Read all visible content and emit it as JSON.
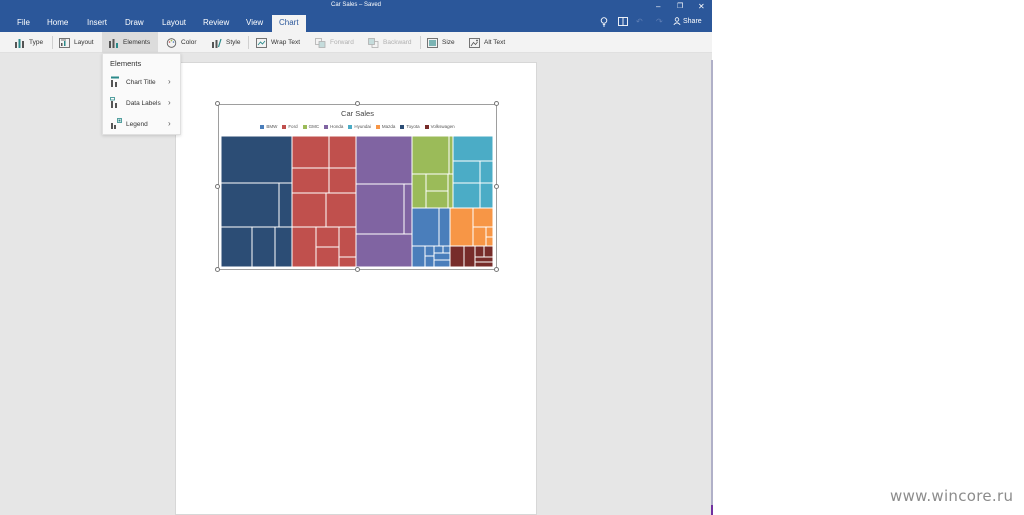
{
  "window": {
    "title": "Car Sales – Saved"
  },
  "tabs": [
    "File",
    "Home",
    "Insert",
    "Draw",
    "Layout",
    "Review",
    "View",
    "Chart"
  ],
  "active_tab": "Chart",
  "share_label": "Share",
  "commands": {
    "type": "Type",
    "layout": "Layout",
    "elements": "Elements",
    "color": "Color",
    "style": "Style",
    "wrap_text": "Wrap Text",
    "forward": "Forward",
    "backward": "Backward",
    "size": "Size",
    "alt_text": "Alt Text"
  },
  "elements_menu": {
    "header": "Elements",
    "items": [
      "Chart Title",
      "Data Labels",
      "Legend"
    ]
  },
  "chart_data": {
    "type": "treemap",
    "title": "Car Sales",
    "legend": [
      "BMW",
      "Ford",
      "GMC",
      "Honda",
      "Hyundai",
      "Mazda",
      "Toyota",
      "Volkswagen"
    ],
    "colors": {
      "BMW": "#4a7ebb",
      "Ford": "#c0504d",
      "GMC": "#9bbb59",
      "Honda": "#8064a2",
      "Hyundai": "#4bacc6",
      "Mazda": "#f79646",
      "Toyota": "#2c4d75",
      "Volkswagen": "#772c2a"
    }
  },
  "watermark": "www.wincore.ru"
}
